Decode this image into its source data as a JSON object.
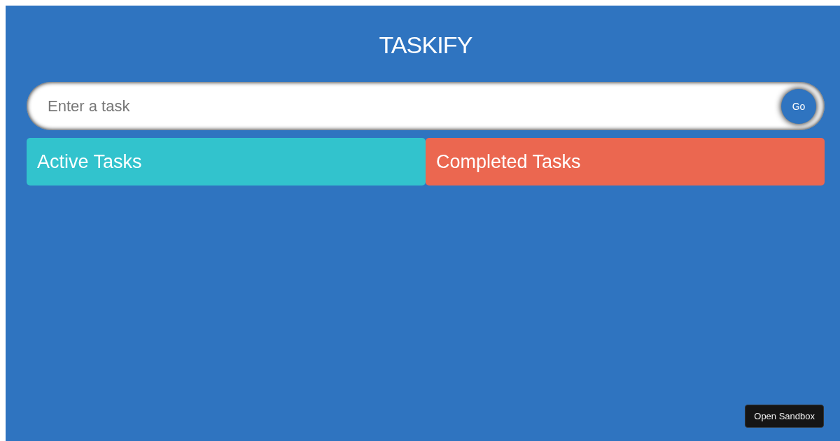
{
  "title": "TASKIFY",
  "task_input": {
    "placeholder": "Enter a task",
    "submit_button": "Go"
  },
  "lists": [
    {
      "kind": "active",
      "title": "Active Tasks"
    },
    {
      "kind": "completed",
      "title": "Completed Tasks"
    }
  ],
  "sandbox_button": "Open Sandbox"
}
